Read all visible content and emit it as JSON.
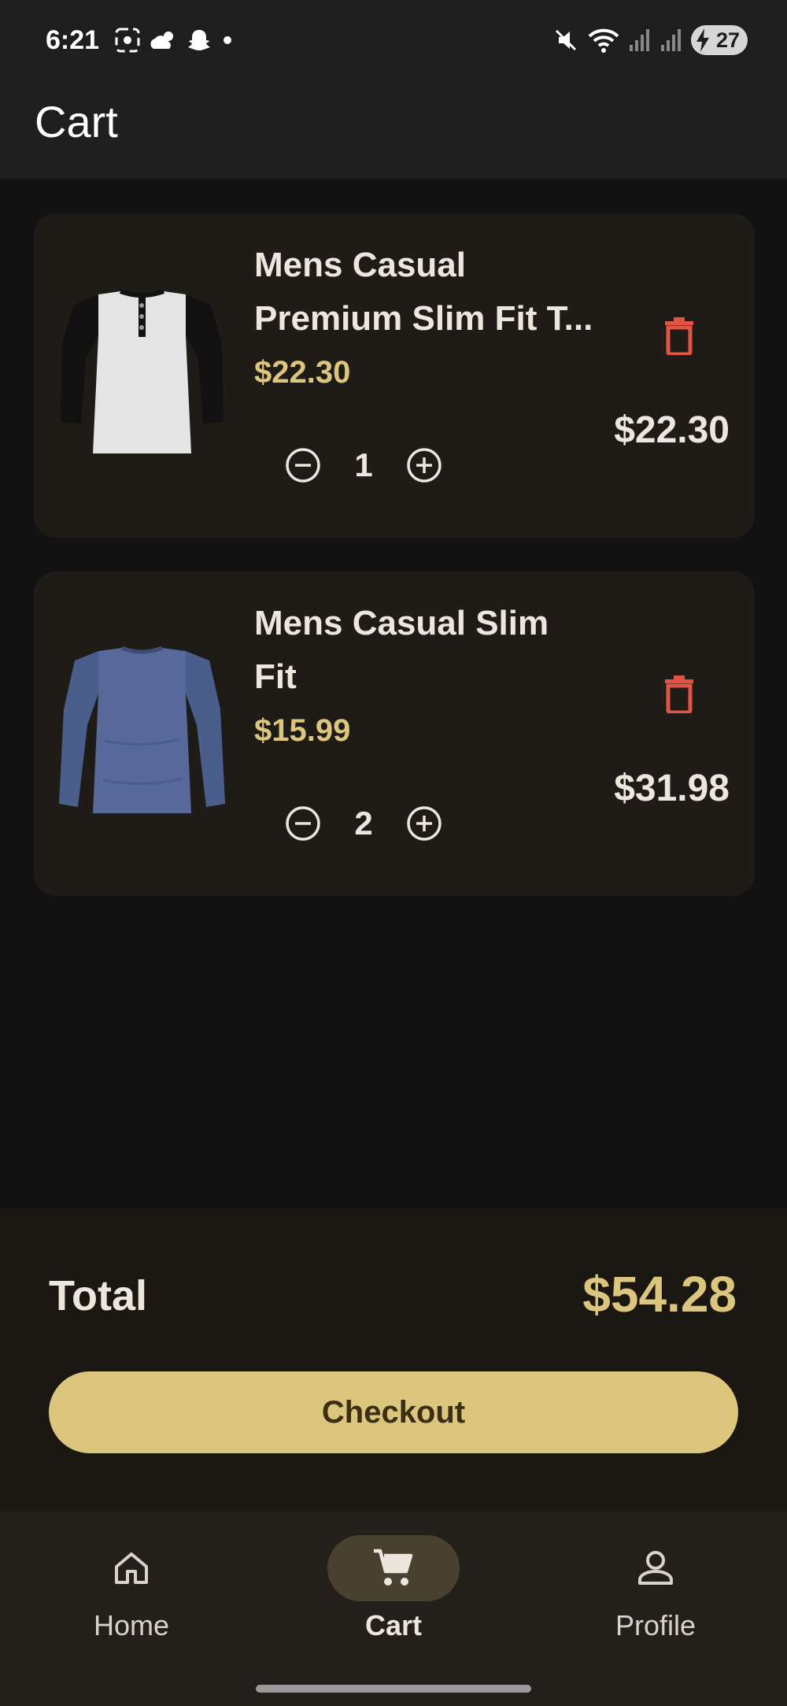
{
  "status_bar": {
    "time": "6:21",
    "battery_level": "27",
    "left_icons": [
      "screen-record-icon",
      "cloud-sun-icon",
      "snapchat-icon",
      "dot-icon"
    ],
    "right_icons": [
      "mute-icon",
      "wifi-icon",
      "signal-icon",
      "signal-icon",
      "battery-charging-icon"
    ]
  },
  "app_bar": {
    "title": "Cart"
  },
  "cart": {
    "items": [
      {
        "name_line1": "Mens Casual",
        "name_line2": "Premium Slim Fit T...",
        "unit_price": "$22.30",
        "quantity": "1",
        "line_total": "$22.30",
        "image": "raglan-henley-shirt-image"
      },
      {
        "name_line1": "Mens Casual Slim",
        "name_line2": "Fit",
        "unit_price": "$15.99",
        "quantity": "2",
        "line_total": "$31.98",
        "image": "blue-long-sleeve-shirt-image"
      }
    ]
  },
  "summary": {
    "total_label": "Total",
    "total_value": "$54.28",
    "checkout_label": "Checkout"
  },
  "bottom_nav": {
    "items": [
      {
        "label": "Home",
        "icon": "home-icon"
      },
      {
        "label": "Cart",
        "icon": "cart-icon",
        "active": true
      },
      {
        "label": "Profile",
        "icon": "person-icon"
      }
    ]
  },
  "colors": {
    "background": "#121212",
    "card": "#1f1c18",
    "accent": "#dcc57c",
    "delete": "#e05545",
    "text": "#ece6dc"
  }
}
